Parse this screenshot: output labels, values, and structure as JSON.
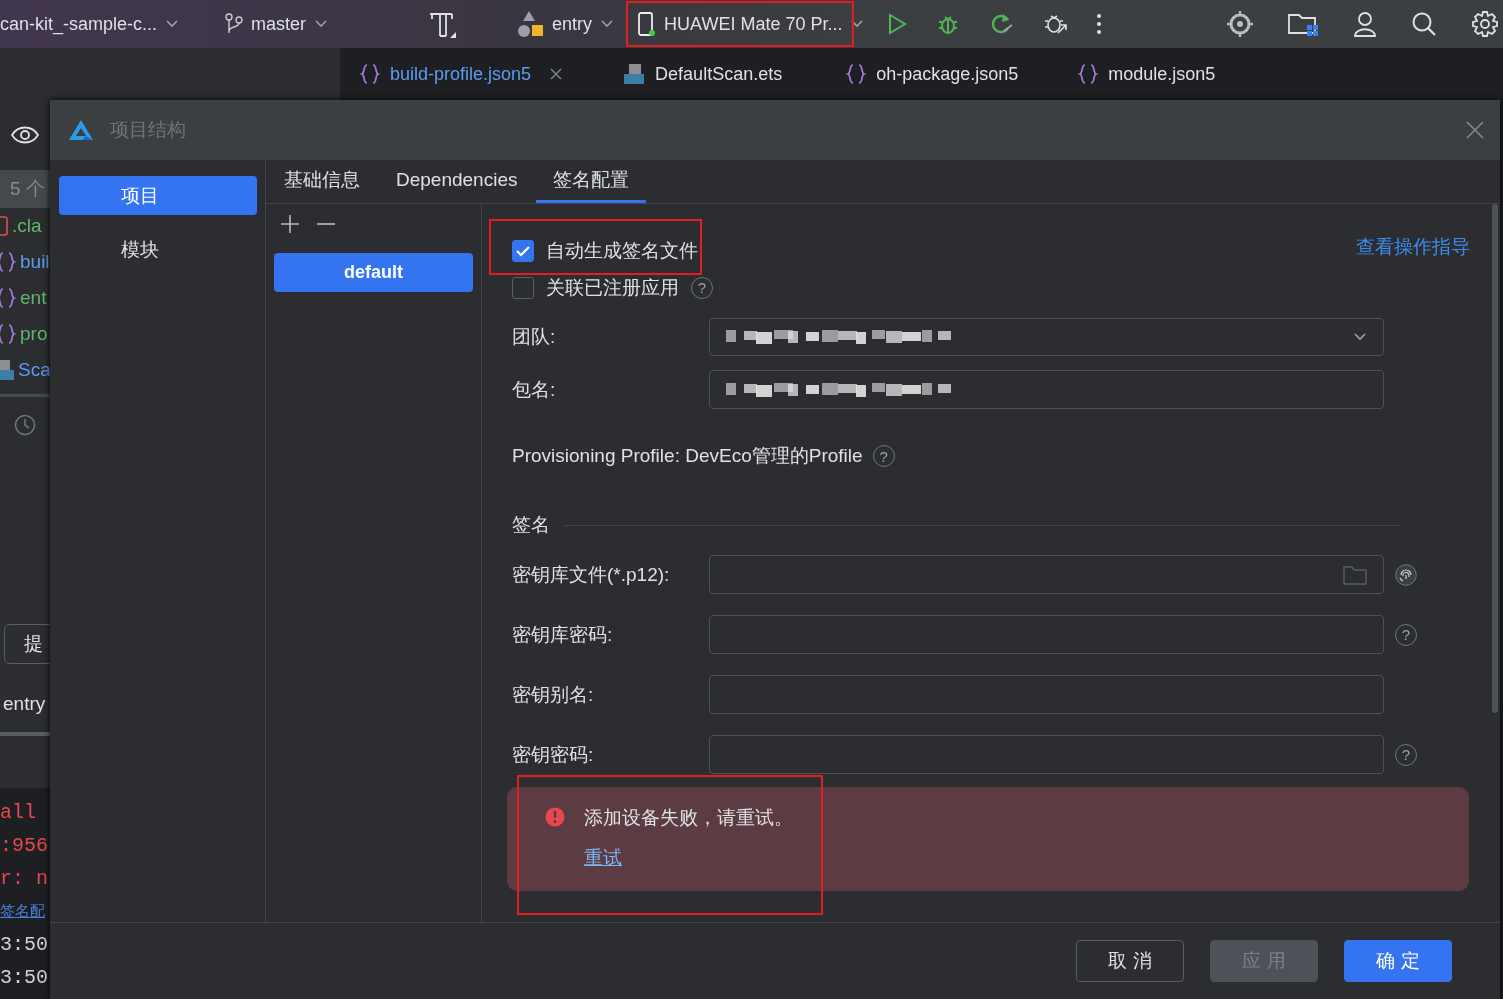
{
  "toolbar": {
    "project": "can-kit_-sample-c...",
    "branch": "master",
    "module": "entry",
    "device": {
      "label": "HUAWEI Mate 70 Pr...",
      "highlighted": true
    }
  },
  "editor_tabs": [
    {
      "label": "build-profile.json5",
      "kind": "json",
      "selected": true,
      "closable": true
    },
    {
      "label": "DefaultScan.ets",
      "kind": "ets",
      "selected": false,
      "closable": false
    },
    {
      "label": "oh-package.json5",
      "kind": "json",
      "selected": false,
      "closable": false
    },
    {
      "label": "module.json5",
      "kind": "json",
      "selected": false,
      "closable": false
    }
  ],
  "side_strip": {
    "count": "5 个",
    "files": [
      {
        "label": ".cla",
        "kind": "yaml"
      },
      {
        "label": "buil",
        "kind": "json"
      },
      {
        "label": "ent",
        "kind": "json"
      },
      {
        "label": "pro",
        "kind": "json"
      },
      {
        "label": "Sca",
        "kind": "ts"
      }
    ],
    "commit_button": "提",
    "module": "entry",
    "console": [
      {
        "text": "all",
        "kind": "error"
      },
      {
        "text": ":956",
        "kind": "error"
      },
      {
        "text": "r: n",
        "kind": "error"
      },
      {
        "text": "签名配",
        "kind": "link"
      },
      {
        "text": "3:50",
        "kind": "plain"
      },
      {
        "text": "3:50",
        "kind": "plain"
      }
    ]
  },
  "dialog": {
    "title": "项目结构",
    "nav": [
      {
        "label": "项目",
        "selected": true
      },
      {
        "label": "模块",
        "selected": false
      }
    ],
    "tabs": [
      {
        "label": "基础信息",
        "selected": false
      },
      {
        "label": "Dependencies",
        "selected": false
      },
      {
        "label": "签名配置",
        "selected": true
      }
    ],
    "profiles": [
      {
        "label": "default",
        "selected": true
      }
    ],
    "guide_link": "查看操作指导",
    "options": [
      {
        "label": "自动生成签名文件",
        "checked": true,
        "highlighted": true
      },
      {
        "label": "关联已注册应用",
        "checked": false,
        "help": "?"
      }
    ],
    "fields": [
      {
        "label": "团队:",
        "kind": "dropdown",
        "redacted": true
      },
      {
        "label": "包名:",
        "kind": "text",
        "redacted": true
      }
    ],
    "provisioning": {
      "text": "Provisioning Profile: DevEco管理的Profile",
      "help": "?"
    },
    "section": "签名",
    "key_fields": [
      {
        "label": "密钥库文件(*.p12):",
        "kind": "file"
      },
      {
        "label": "密钥库密码:",
        "kind": "text",
        "help": "?"
      },
      {
        "label": "密钥别名:",
        "kind": "text"
      },
      {
        "label": "密钥密码:",
        "kind": "text",
        "help": "?"
      }
    ],
    "toast": {
      "message": "添加设备失败，请重试。",
      "action": "重试",
      "highlighted": true
    },
    "buttons": [
      {
        "label": "取 消",
        "kind": "secondary"
      },
      {
        "label": "应 用",
        "kind": "disabled"
      },
      {
        "label": "确 定",
        "kind": "primary"
      }
    ]
  }
}
